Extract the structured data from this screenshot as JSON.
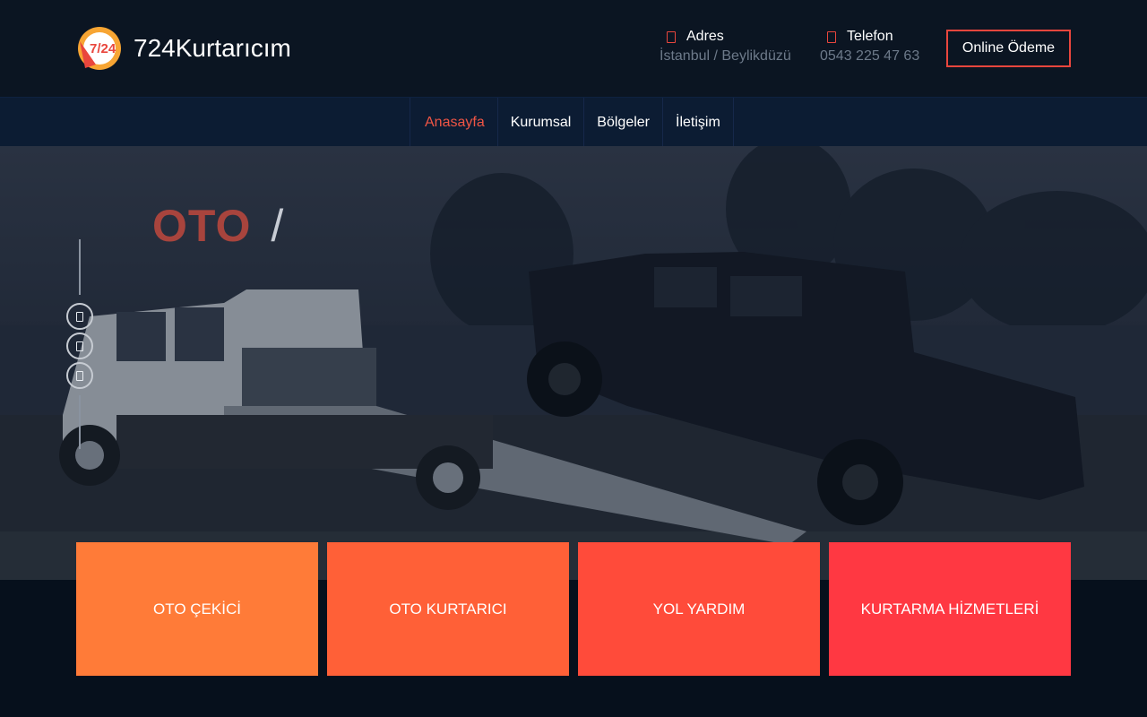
{
  "brand": {
    "name": "724Kurtarıcım",
    "badge_text": "7/24"
  },
  "contact": {
    "address": {
      "icon": "map-marker-icon",
      "label": "Adres",
      "value": "İstanbul / Beylikdüzü"
    },
    "phone": {
      "icon": "phone-icon",
      "label": "Telefon",
      "value": "0543 225 47 63"
    }
  },
  "header": {
    "pay_button": "Online Ödeme"
  },
  "nav": {
    "items": [
      {
        "label": "Anasayfa",
        "active": true
      },
      {
        "label": "Kurumsal",
        "active": false
      },
      {
        "label": "Bölgeler",
        "active": false
      },
      {
        "label": "İletişim",
        "active": false
      }
    ]
  },
  "hero": {
    "title": "OTO",
    "separator": "/",
    "slides": 3
  },
  "services": [
    {
      "label": "OTO ÇEKİCİ",
      "color": "#ff7b38"
    },
    {
      "label": "OTO KURTARICI",
      "color": "#ff6037"
    },
    {
      "label": "YOL YARDIM",
      "color": "#ff4b3a"
    },
    {
      "label": "KURTARMA HİZMETLERİ",
      "color": "#ff3842"
    }
  ],
  "colors": {
    "accent": "#e9463d",
    "header_bg": "#0b1522",
    "nav_bg": "#0c1c33",
    "page_bg": "#06101c"
  }
}
